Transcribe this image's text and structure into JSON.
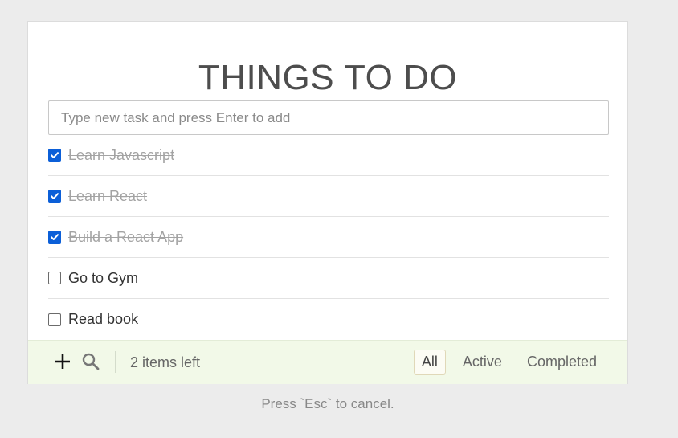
{
  "app": {
    "title": "THINGS TO DO"
  },
  "new_task": {
    "placeholder": "Type new task and press Enter to add",
    "value": ""
  },
  "todos": [
    {
      "label": "Learn Javascript",
      "completed": true
    },
    {
      "label": "Learn React",
      "completed": true
    },
    {
      "label": "Build a React App",
      "completed": true
    },
    {
      "label": "Go to Gym",
      "completed": false
    },
    {
      "label": "Read book",
      "completed": false
    }
  ],
  "footer": {
    "add_icon": "plus-icon",
    "search_icon": "search-icon",
    "items_left": "2 items left",
    "filters": [
      {
        "label": "All",
        "selected": true
      },
      {
        "label": "Active",
        "selected": false
      },
      {
        "label": "Completed",
        "selected": false
      }
    ]
  },
  "hint": "Press `Esc` to cancel.",
  "colors": {
    "checkbox_checked": "#0b5fd8",
    "footer_bg": "#f2f9e8",
    "page_bg": "#ececec",
    "title": "#4d4d4d"
  }
}
